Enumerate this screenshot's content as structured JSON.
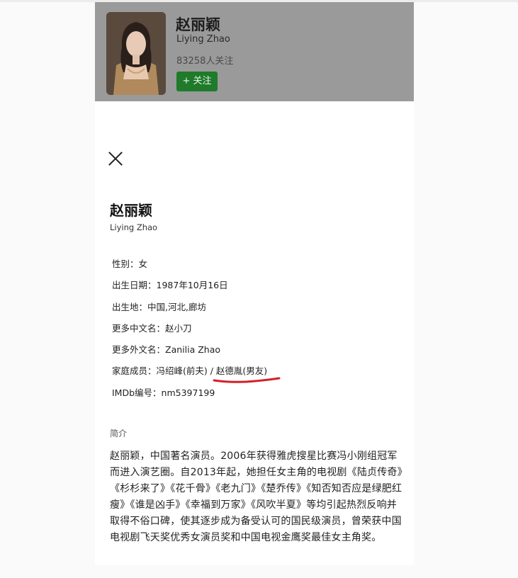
{
  "header": {
    "name": "赵丽颖",
    "english_name": "Liying Zhao",
    "follower_count": "83258人关注",
    "follow_button": "+ 关注"
  },
  "profile": {
    "title": "赵丽颖",
    "subtitle": "Liying Zhao",
    "info": [
      {
        "label": "性别：",
        "value": "女"
      },
      {
        "label": "出生日期：",
        "value": "1987年10月16日"
      },
      {
        "label": "出生地：",
        "value": "中国,河北,廊坊"
      },
      {
        "label": "更多中文名：",
        "value": "赵小刀"
      },
      {
        "label": "更多外文名：",
        "value": "Zanilia Zhao"
      },
      {
        "label": "家庭成员：",
        "value": "冯绍峰(前夫) / 赵德胤(男友)"
      },
      {
        "label": "IMDb编号：",
        "value": "nm5397199"
      }
    ]
  },
  "intro": {
    "label": "简介",
    "text": "赵丽颖，中国著名演员。2006年获得雅虎搜星比赛冯小刚组冠军而进入演艺圈。自2013年起，她担任女主角的电视剧《陆贞传奇》《杉杉来了》《花千骨》《老九门》《楚乔传》《知否知否应是绿肥红瘦》《谁是凶手》《幸福到万家》《风吹半夏》等均引起热烈反响并取得不俗口碑，使其逐步成为备受认可的国民级演员，曾荣获中国电视剧飞天奖优秀女演员奖和中国电视金鹰奖最佳女主角奖。"
  },
  "colors": {
    "header_overlay": "#9a9a9a",
    "follow_button": "#1f7a2a",
    "annotation_underline": "#d1202a"
  },
  "icons": {
    "close": "close-icon"
  }
}
